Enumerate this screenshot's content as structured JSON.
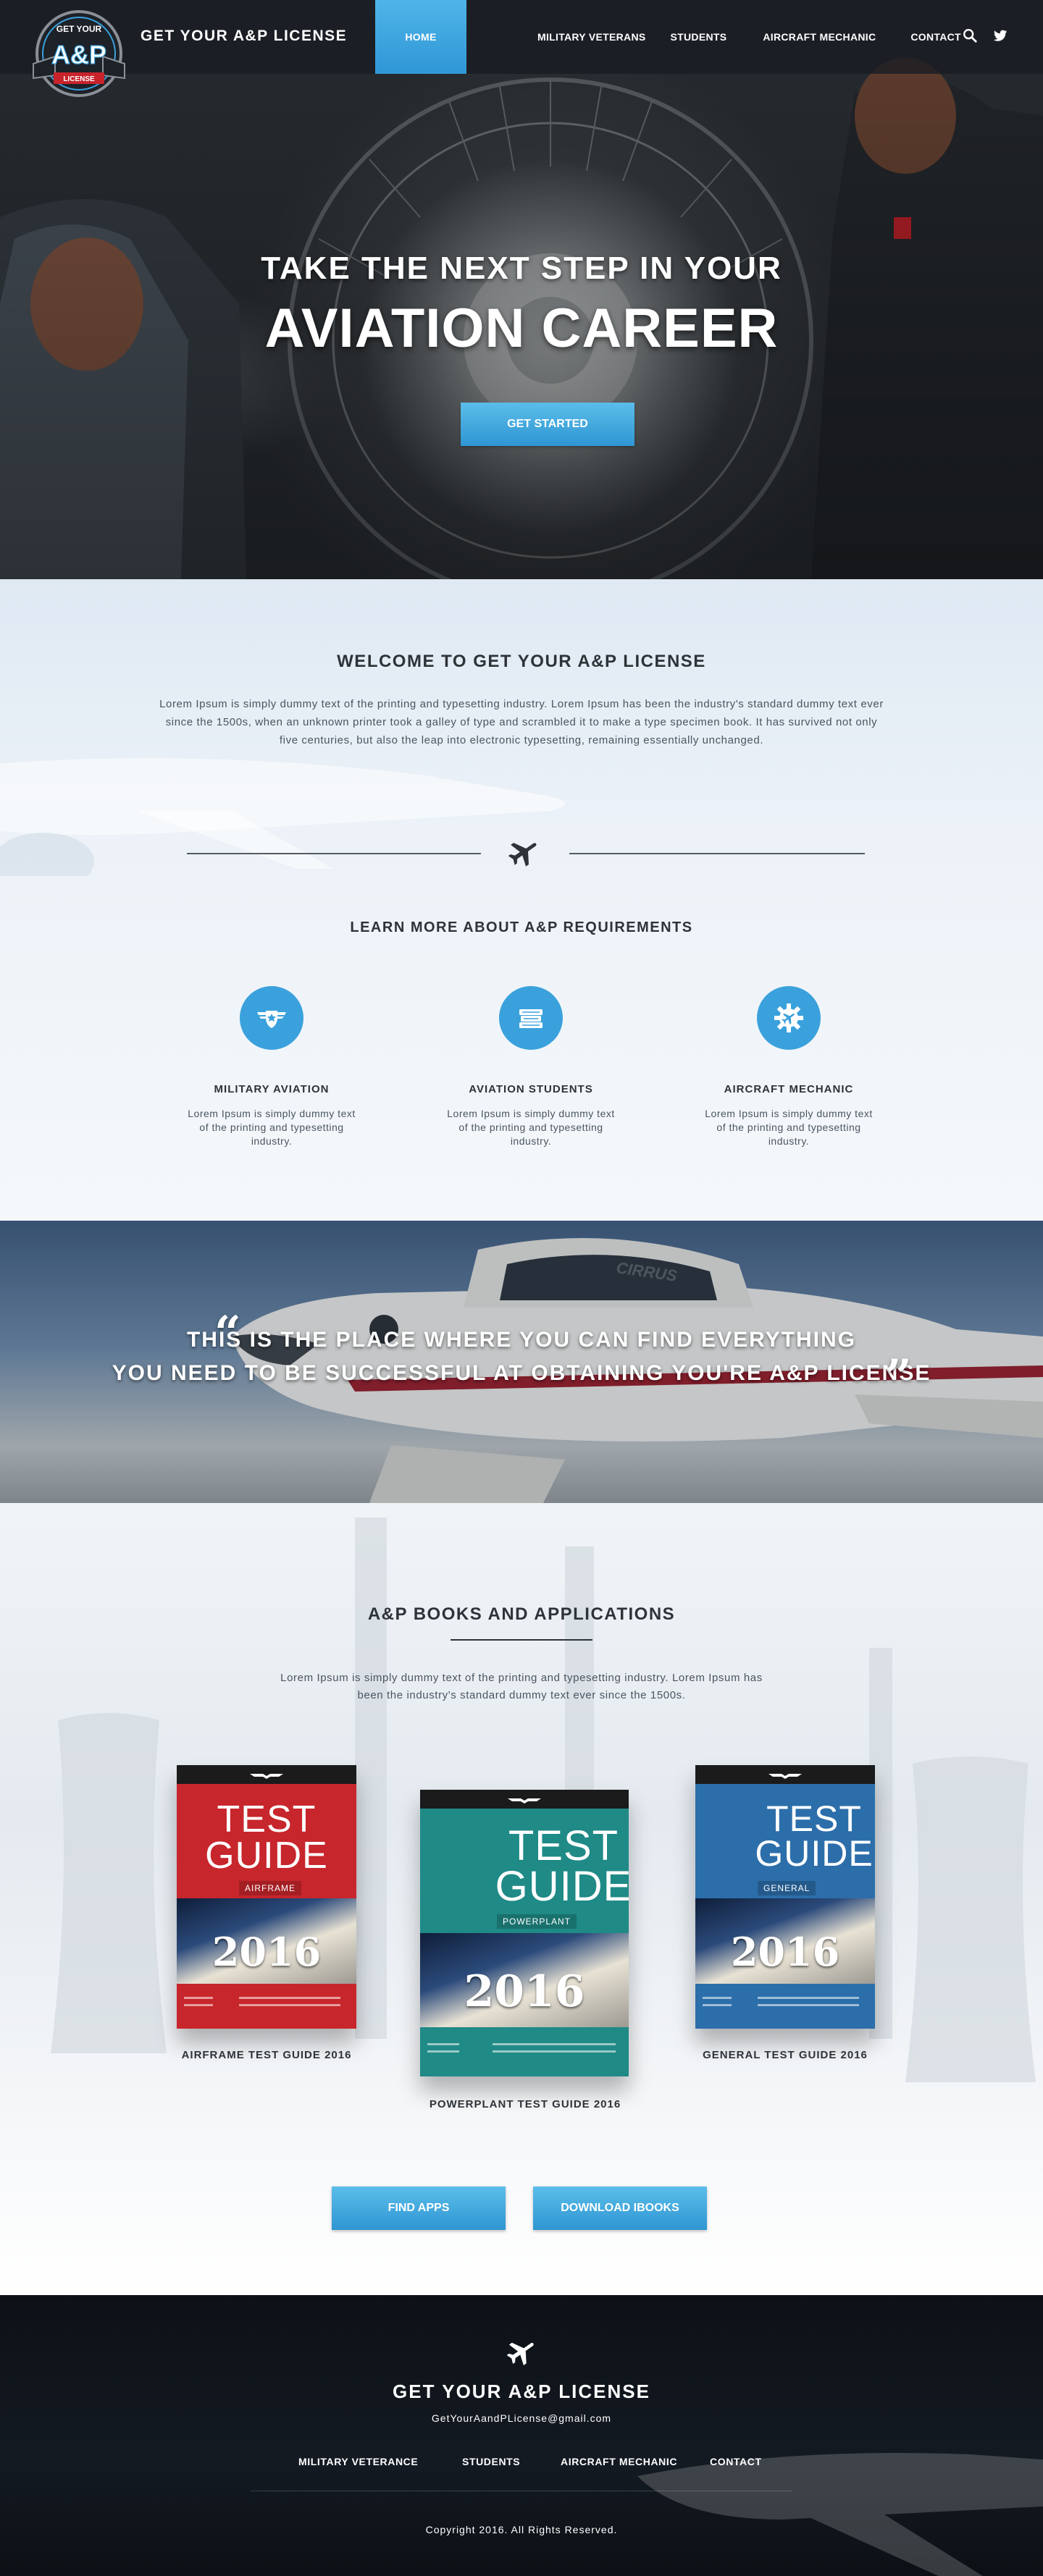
{
  "header": {
    "brand": "GET YOUR A&P LICENSE",
    "logo": {
      "line1": "GET YOUR",
      "line2": "A&P",
      "line3": "LICENSE"
    },
    "nav": [
      {
        "label": "HOME",
        "active": true
      },
      {
        "label": "MILITARY VETERANS"
      },
      {
        "label": "STUDENTS"
      },
      {
        "label": "AIRCRAFT MECHANIC"
      },
      {
        "label": "CONTACT"
      }
    ],
    "icons": [
      "search-icon",
      "twitter-icon"
    ]
  },
  "hero": {
    "line1": "TAKE THE NEXT STEP IN YOUR",
    "line2": "AVIATION CAREER",
    "cta": "GET STARTED"
  },
  "welcome": {
    "title": "WELCOME TO GET YOUR A&P LICENSE",
    "body": "Lorem Ipsum is simply dummy text of the printing and typesetting industry. Lorem Ipsum has been the industry's standard dummy text ever since the 1500s, when an unknown printer took a galley of type and scrambled it to make a type specimen book. It has survived not only five centuries, but also the leap into electronic typesetting, remaining essentially unchanged."
  },
  "requirements": {
    "title": "LEARN MORE ABOUT A&P REQUIREMENTS",
    "items": [
      {
        "icon": "military-wings-icon",
        "title": "MILITARY AVIATION",
        "text": "Lorem Ipsum is simply dummy text of the printing and typesetting industry."
      },
      {
        "icon": "books-icon",
        "title": "AVIATION STUDENTS",
        "text": "Lorem Ipsum is simply dummy text of the printing and typesetting industry."
      },
      {
        "icon": "gear-plane-icon",
        "title": "AIRCRAFT MECHANIC",
        "text": "Lorem Ipsum is simply dummy text of the printing and typesetting industry."
      }
    ]
  },
  "quote": {
    "line1": "THIS IS THE PLACE WHERE YOU CAN FIND EVERYTHING",
    "line2": "YOU NEED TO BE SUCCESSFUL AT OBTAINING YOU'RE A&P LICENSE",
    "open_mark": "“",
    "close_mark": "”",
    "plane_text": "CIRRUS"
  },
  "books": {
    "title": "A&P BOOKS AND APPLICATIONS",
    "body": "Lorem Ipsum is simply dummy text of the printing and typesetting industry. Lorem Ipsum has been the industry's standard dummy text ever since the 1500s.",
    "items": [
      {
        "word1": "TEST",
        "word2": "GUIDE",
        "edition": "AIRFRAME",
        "year": "2016",
        "caption": "AIRFRAME TEST GUIDE 2016",
        "color": "#c7262c"
      },
      {
        "word1": "TEST",
        "word2": "GUIDE",
        "edition": "POWERPLANT",
        "year": "2016",
        "caption": "POWERPLANT TEST GUIDE 2016",
        "color": "#1f8a86"
      },
      {
        "word1": "TEST",
        "word2": "GUIDE",
        "edition": "GENERAL",
        "year": "2016",
        "caption": "GENERAL TEST GUIDE 2016",
        "color": "#2c6eaa"
      }
    ],
    "buttons": {
      "apps": "FIND APPS",
      "ibooks": "DOWNLOAD IBOOKS"
    }
  },
  "footer": {
    "title": "GET YOUR A&P LICENSE",
    "email": "GetYourAandPLicense@gmail.com",
    "nav": [
      "MILITARY VETERANCE",
      "STUDENTS",
      "AIRCRAFT MECHANIC",
      "CONTACT"
    ],
    "copyright": "Copyright 2016. All Rights Reserved."
  },
  "colors": {
    "accent": "#3aa1dc",
    "nav_bar": "#181c22",
    "heading": "#2d3338",
    "footer_bg": "#0d1117"
  }
}
